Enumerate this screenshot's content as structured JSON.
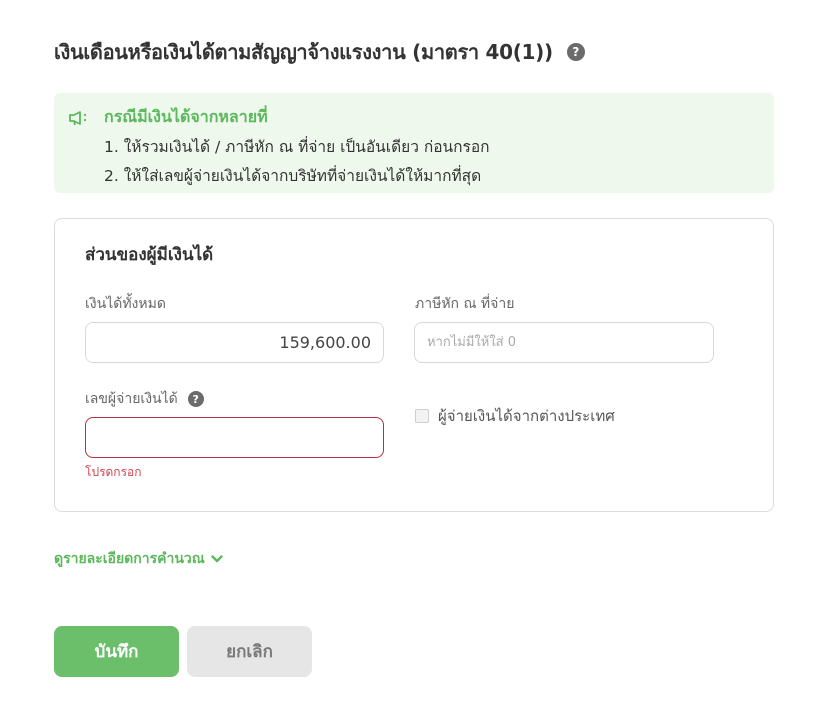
{
  "header": {
    "title": "เงินเดือนหรือเงินได้ตามสัญญาจ้างแรงงาน (มาตรา 40(1))",
    "help_icon": "question-circle-icon"
  },
  "notice": {
    "icon": "megaphone-icon",
    "title": "กรณีมีเงินได้จากหลายที่",
    "lines": [
      "1. ให้รวมเงินได้ / ภาษีหัก ณ ที่จ่าย เป็นอันเดียว ก่อนกรอก",
      "2. ให้ใส่เลขผู้จ่ายเงินได้จากบริษัทที่จ่ายเงินได้ให้มากที่สุด"
    ]
  },
  "form": {
    "section_title": "ส่วนของผู้มีเงินได้",
    "total_income": {
      "label": "เงินได้ทั้งหมด",
      "value": "159,600.00"
    },
    "withholding_tax": {
      "label": "ภาษีหัก ณ ที่จ่าย",
      "placeholder": "หากไม่มีให้ใส่ 0"
    },
    "payer_id": {
      "label": "เลขผู้จ่ายเงินได้",
      "value": "",
      "error": "โปรดกรอก"
    },
    "foreign_payer": {
      "label": "ผู้จ่ายเงินได้จากต่างประเทศ",
      "checked": false
    }
  },
  "detail_link": {
    "label": "ดูรายละเอียดการคำนวณ",
    "icon": "chevron-down-icon"
  },
  "actions": {
    "save_label": "บันทึก",
    "cancel_label": "ยกเลิก"
  },
  "colors": {
    "accent": "#5cb85c",
    "notice_bg": "#eef8ec",
    "error": "#b8323e",
    "save_bg": "#6bbf6b",
    "cancel_bg": "#e6e6e6"
  }
}
